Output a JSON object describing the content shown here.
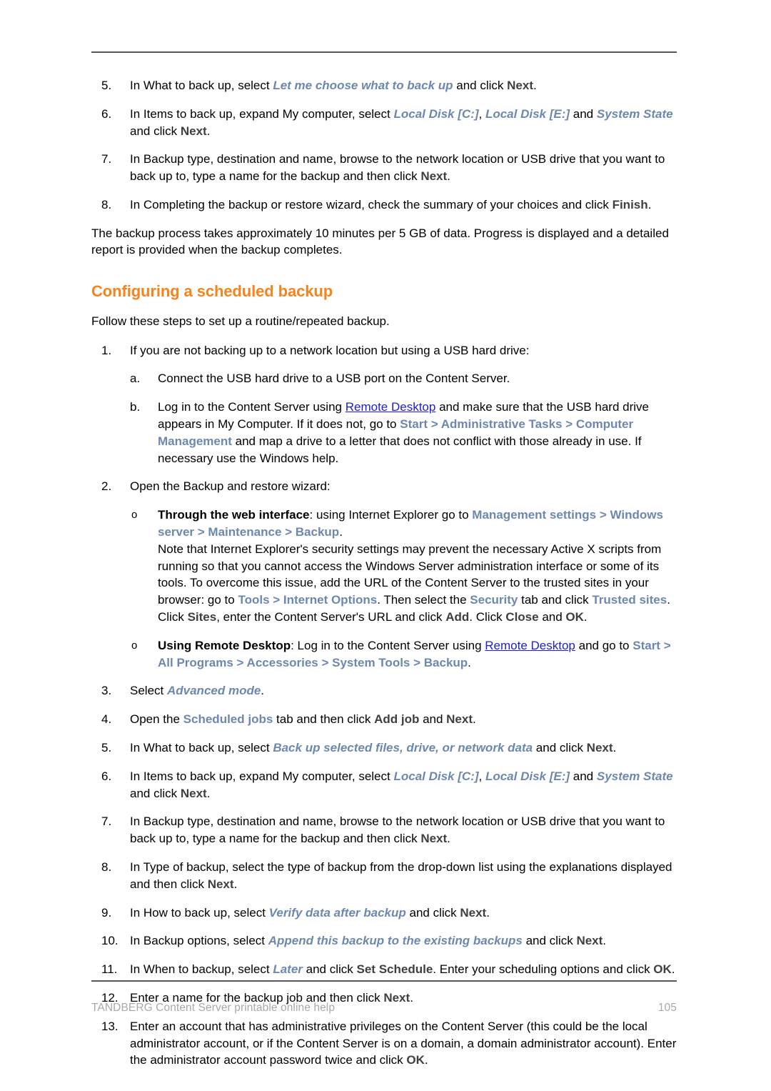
{
  "document": {
    "footer_text": "TANDBERG Content Server printable online help",
    "page_number": "105",
    "colors": {
      "heading_orange": "#f5841f",
      "ui_reference_blue": "#6d88ae",
      "hyperlink_blue": "#2020cc",
      "bold_label_gray": "#3f3f3f",
      "footer_gray": "#a7a9ac",
      "rule_gray": "#58585a"
    }
  },
  "top_steps": [
    {
      "marker": "5.",
      "parts": [
        {
          "text": "In What to back up, select ",
          "style": "plain"
        },
        {
          "text": "Let me choose what to back up",
          "style": "opt"
        },
        {
          "text": " and click ",
          "style": "plain"
        },
        {
          "text": "Next",
          "style": "b"
        },
        {
          "text": ".",
          "style": "plain"
        }
      ]
    },
    {
      "marker": "6.",
      "parts": [
        {
          "text": "In Items to back up, expand My computer, select ",
          "style": "plain"
        },
        {
          "text": "Local Disk [C:]",
          "style": "opt"
        },
        {
          "text": ", ",
          "style": "plain"
        },
        {
          "text": "Local Disk [E:]",
          "style": "opt"
        },
        {
          "text": " and ",
          "style": "plain"
        },
        {
          "text": "System State",
          "style": "opt"
        },
        {
          "text": " and click ",
          "style": "plain"
        },
        {
          "text": "Next",
          "style": "b"
        },
        {
          "text": ".",
          "style": "plain"
        }
      ]
    },
    {
      "marker": "7.",
      "parts": [
        {
          "text": "In Backup type, destination and name, browse to the network location or USB drive that you want to back up to, type a name for the backup and then click ",
          "style": "plain"
        },
        {
          "text": "Next",
          "style": "b"
        },
        {
          "text": ".",
          "style": "plain"
        }
      ]
    },
    {
      "marker": "8.",
      "parts": [
        {
          "text": "In Completing the backup or restore wizard, check the summary of your choices and click ",
          "style": "plain"
        },
        {
          "text": "Finish",
          "style": "b"
        },
        {
          "text": ".",
          "style": "plain"
        }
      ]
    }
  ],
  "intro_paragraph": "The backup process takes approximately 10 minutes per 5 GB of data. Progress is displayed and a detailed report is provided when the backup completes.",
  "heading": "Configuring a scheduled backup",
  "lead_paragraph": "Follow these steps to set up a routine/repeated backup.",
  "main_steps": [
    {
      "marker": "1.",
      "level": "step",
      "parts": [
        {
          "text": "If you are not backing up to a network location but using a USB hard drive:",
          "style": "plain"
        }
      ]
    },
    {
      "marker": "a.",
      "level": "sub",
      "parts": [
        {
          "text": "Connect the USB hard drive to a USB port on the Content Server.",
          "style": "plain"
        }
      ]
    },
    {
      "marker": "b.",
      "level": "sub",
      "parts": [
        {
          "text": "Log in to the Content Server using ",
          "style": "plain"
        },
        {
          "text": "Remote Desktop",
          "style": "link"
        },
        {
          "text": " and make sure that the USB hard drive appears in My Computer. If it does not, go to ",
          "style": "plain"
        },
        {
          "text": "Start > Administrative Tasks > Computer Management",
          "style": "ui"
        },
        {
          "text": " and map a drive to a letter that does not conflict with those already in use. If necessary use the Windows help.",
          "style": "plain"
        }
      ]
    },
    {
      "marker": "2.",
      "level": "step",
      "parts": [
        {
          "text": "Open the Backup and restore wizard:",
          "style": "plain"
        }
      ]
    },
    {
      "marker": "o",
      "level": "obul",
      "parts": [
        {
          "text": "Through the web interface",
          "style": "bk"
        },
        {
          "text": ": using Internet Explorer go to ",
          "style": "plain"
        },
        {
          "text": "Management settings > Windows server > Maintenance > Backup",
          "style": "ui"
        },
        {
          "text": ".",
          "style": "plain"
        },
        {
          "text": "\n",
          "style": "br"
        },
        {
          "text": "Note that Internet Explorer's security settings may prevent the necessary Active X scripts from running so that you cannot access the Windows Server administration interface or some of its tools. To overcome this issue, add the URL of the Content Server to the trusted sites in your browser: go to ",
          "style": "plain"
        },
        {
          "text": "Tools > Internet Options",
          "style": "ui"
        },
        {
          "text": ". Then select the ",
          "style": "plain"
        },
        {
          "text": "Security",
          "style": "ui"
        },
        {
          "text": " tab and click ",
          "style": "plain"
        },
        {
          "text": "Trusted sites",
          "style": "ui"
        },
        {
          "text": ". Click ",
          "style": "plain"
        },
        {
          "text": "Sites",
          "style": "b"
        },
        {
          "text": ", enter the Content Server's URL and click ",
          "style": "plain"
        },
        {
          "text": "Add",
          "style": "b"
        },
        {
          "text": ". Click ",
          "style": "plain"
        },
        {
          "text": "Close",
          "style": "b"
        },
        {
          "text": " and ",
          "style": "plain"
        },
        {
          "text": "OK",
          "style": "b"
        },
        {
          "text": ".",
          "style": "plain"
        }
      ]
    },
    {
      "marker": "o",
      "level": "obul",
      "parts": [
        {
          "text": "Using Remote Desktop",
          "style": "bk"
        },
        {
          "text": ": Log in to the Content Server using ",
          "style": "plain"
        },
        {
          "text": "Remote Desktop",
          "style": "link"
        },
        {
          "text": " and go to ",
          "style": "plain"
        },
        {
          "text": "Start > All Programs > Accessories > System Tools > Backup",
          "style": "ui"
        },
        {
          "text": ".",
          "style": "plain"
        }
      ]
    },
    {
      "marker": "3.",
      "level": "step",
      "parts": [
        {
          "text": "Select ",
          "style": "plain"
        },
        {
          "text": "Advanced mode",
          "style": "opt"
        },
        {
          "text": ".",
          "style": "plain"
        }
      ]
    },
    {
      "marker": "4.",
      "level": "step",
      "parts": [
        {
          "text": "Open the ",
          "style": "plain"
        },
        {
          "text": "Scheduled jobs",
          "style": "ui"
        },
        {
          "text": " tab and then click ",
          "style": "plain"
        },
        {
          "text": "Add job",
          "style": "b"
        },
        {
          "text": " and ",
          "style": "plain"
        },
        {
          "text": "Next",
          "style": "b"
        },
        {
          "text": ".",
          "style": "plain"
        }
      ]
    },
    {
      "marker": "5.",
      "level": "step",
      "parts": [
        {
          "text": "In What to back up, select ",
          "style": "plain"
        },
        {
          "text": "Back up selected files, drive, or network data",
          "style": "opt"
        },
        {
          "text": " and click ",
          "style": "plain"
        },
        {
          "text": "Next",
          "style": "b"
        },
        {
          "text": ".",
          "style": "plain"
        }
      ]
    },
    {
      "marker": "6.",
      "level": "step",
      "parts": [
        {
          "text": "In Items to back up, expand My computer, select ",
          "style": "plain"
        },
        {
          "text": "Local Disk [C:]",
          "style": "opt"
        },
        {
          "text": ", ",
          "style": "plain"
        },
        {
          "text": "Local Disk [E:]",
          "style": "opt"
        },
        {
          "text": " and ",
          "style": "plain"
        },
        {
          "text": "System State",
          "style": "opt"
        },
        {
          "text": " and click ",
          "style": "plain"
        },
        {
          "text": "Next",
          "style": "b"
        },
        {
          "text": ".",
          "style": "plain"
        }
      ]
    },
    {
      "marker": "7.",
      "level": "step",
      "parts": [
        {
          "text": "In Backup type, destination and name, browse to the network location or USB drive that you want to back up to, type a name for the backup and then click ",
          "style": "plain"
        },
        {
          "text": "Next",
          "style": "b"
        },
        {
          "text": ".",
          "style": "plain"
        }
      ]
    },
    {
      "marker": "8.",
      "level": "step",
      "parts": [
        {
          "text": "In Type of backup, select the type of backup from the drop-down list using the explanations displayed and then click ",
          "style": "plain"
        },
        {
          "text": "Next",
          "style": "b"
        },
        {
          "text": ".",
          "style": "plain"
        }
      ]
    },
    {
      "marker": "9.",
      "level": "step",
      "parts": [
        {
          "text": "In How to back up, select ",
          "style": "plain"
        },
        {
          "text": "Verify data after backup",
          "style": "opt"
        },
        {
          "text": " and click ",
          "style": "plain"
        },
        {
          "text": "Next",
          "style": "b"
        },
        {
          "text": ".",
          "style": "plain"
        }
      ]
    },
    {
      "marker": "10.",
      "level": "step",
      "parts": [
        {
          "text": "In Backup options, select ",
          "style": "plain"
        },
        {
          "text": "Append this backup to the existing backups",
          "style": "opt"
        },
        {
          "text": " and click ",
          "style": "plain"
        },
        {
          "text": "Next",
          "style": "b"
        },
        {
          "text": ".",
          "style": "plain"
        }
      ]
    },
    {
      "marker": "11.",
      "level": "step",
      "parts": [
        {
          "text": "In When to backup, select ",
          "style": "plain"
        },
        {
          "text": "Later",
          "style": "opt"
        },
        {
          "text": " and click ",
          "style": "plain"
        },
        {
          "text": "Set Schedule",
          "style": "b"
        },
        {
          "text": ". Enter your scheduling options and click ",
          "style": "plain"
        },
        {
          "text": "OK",
          "style": "b"
        },
        {
          "text": ".",
          "style": "plain"
        }
      ]
    },
    {
      "marker": "12.",
      "level": "step",
      "parts": [
        {
          "text": "Enter a name for the backup job and then click ",
          "style": "plain"
        },
        {
          "text": "Next",
          "style": "b"
        },
        {
          "text": ".",
          "style": "plain"
        }
      ]
    },
    {
      "marker": "13.",
      "level": "step",
      "parts": [
        {
          "text": "Enter an account that has administrative privileges on the Content Server (this could be the local administrator account, or if the Content Server is on a domain, a domain administrator account). Enter the administrator account password twice and click ",
          "style": "plain"
        },
        {
          "text": "OK",
          "style": "b"
        },
        {
          "text": ".",
          "style": "plain"
        }
      ]
    }
  ]
}
